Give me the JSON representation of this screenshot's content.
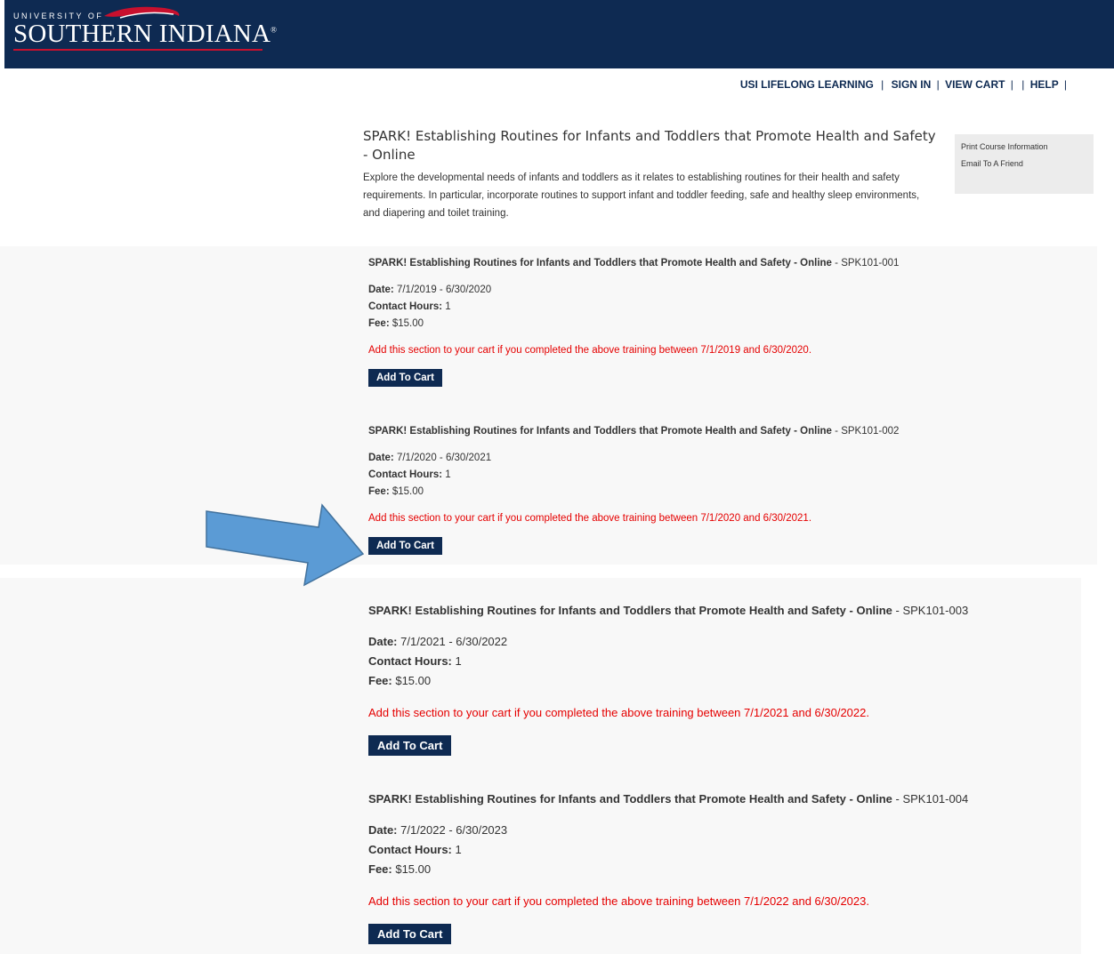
{
  "header": {
    "logo_small": "UNIVERSITY OF",
    "logo_main": "SOUTHERN INDIANA",
    "logo_reg": "®"
  },
  "topnav": {
    "items": [
      "USI LIFELONG LEARNING",
      "SIGN IN",
      "VIEW CART",
      "",
      "HELP"
    ],
    "separator": "|"
  },
  "course": {
    "title": "SPARK! Establishing Routines for Infants and Toddlers that Promote Health and Safety - Online",
    "description": "Explore the developmental needs of infants and toddlers as it relates to establishing routines for their health and safety requirements. In particular, incorporate routines to support infant and toddler feeding, safe and healthy sleep environments, and diapering and toilet training."
  },
  "sidebox": {
    "print_label": "Print Course Information",
    "email_label": "Email To A Friend"
  },
  "labels": {
    "date": "Date:",
    "contact_hours": "Contact Hours:",
    "fee": "Fee:",
    "add_to_cart": "Add To Cart"
  },
  "sections": [
    {
      "title": "SPARK! Establishing Routines for Infants and Toddlers that Promote Health and Safety - Online",
      "code": " - SPK101-001",
      "date": " 7/1/2019 - 6/30/2020",
      "contact_hours": " 1",
      "fee": " $15.00",
      "note": "Add this section to your cart if you completed the above training between 7/1/2019 and 6/30/2020."
    },
    {
      "title": "SPARK! Establishing Routines for Infants and Toddlers that Promote Health and Safety - Online",
      "code": " - SPK101-002",
      "date": " 7/1/2020 - 6/30/2021",
      "contact_hours": " 1",
      "fee": " $15.00",
      "note": "Add this section to your cart if you completed the above training between 7/1/2020 and 6/30/2021."
    },
    {
      "title": "SPARK! Establishing Routines for Infants and Toddlers that Promote Health and Safety - Online",
      "code": " - SPK101-003",
      "date": " 7/1/2021 - 6/30/2022",
      "contact_hours": " 1",
      "fee": " $15.00",
      "note": "Add this section to your cart if you completed the above training between 7/1/2021 and 6/30/2022."
    },
    {
      "title": "SPARK! Establishing Routines for Infants and Toddlers that Promote Health and Safety - Online",
      "code": " - SPK101-004",
      "date": " 7/1/2022 - 6/30/2023",
      "contact_hours": " 1",
      "fee": " $15.00",
      "note": "Add this section to your cart if you completed the above training between 7/1/2022 and 6/30/2023."
    }
  ],
  "colors": {
    "navy": "#0e2a52",
    "red_note": "#e50000",
    "arrow": "#5b9bd5"
  }
}
